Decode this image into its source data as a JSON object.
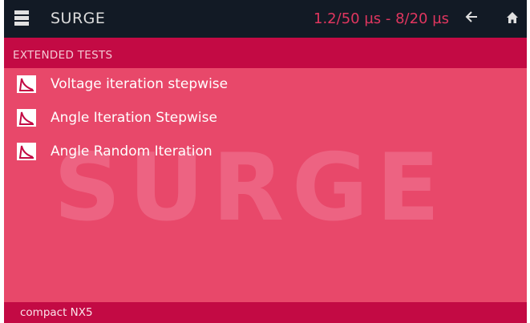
{
  "header": {
    "title": "SURGE",
    "subtitle": "1.2/50 µs - 8/20 µs",
    "menu_icon": "menu-icon",
    "back_icon": "arrow-left-icon",
    "home_icon": "home-icon",
    "subtitle_color": "#e0365f"
  },
  "section": {
    "title": "EXTENDED TESTS"
  },
  "watermark": "SURGE",
  "tests": [
    {
      "label": "Voltage iteration stepwise",
      "icon": "surge-waveform-icon"
    },
    {
      "label": "Angle Iteration Stepwise",
      "icon": "surge-waveform-icon"
    },
    {
      "label": "Angle Random Iteration",
      "icon": "surge-waveform-icon"
    }
  ],
  "footer": {
    "device": "compact NX5"
  },
  "colors": {
    "background": "#e8486a",
    "header": "#121a25",
    "accent": "#c30a44"
  }
}
